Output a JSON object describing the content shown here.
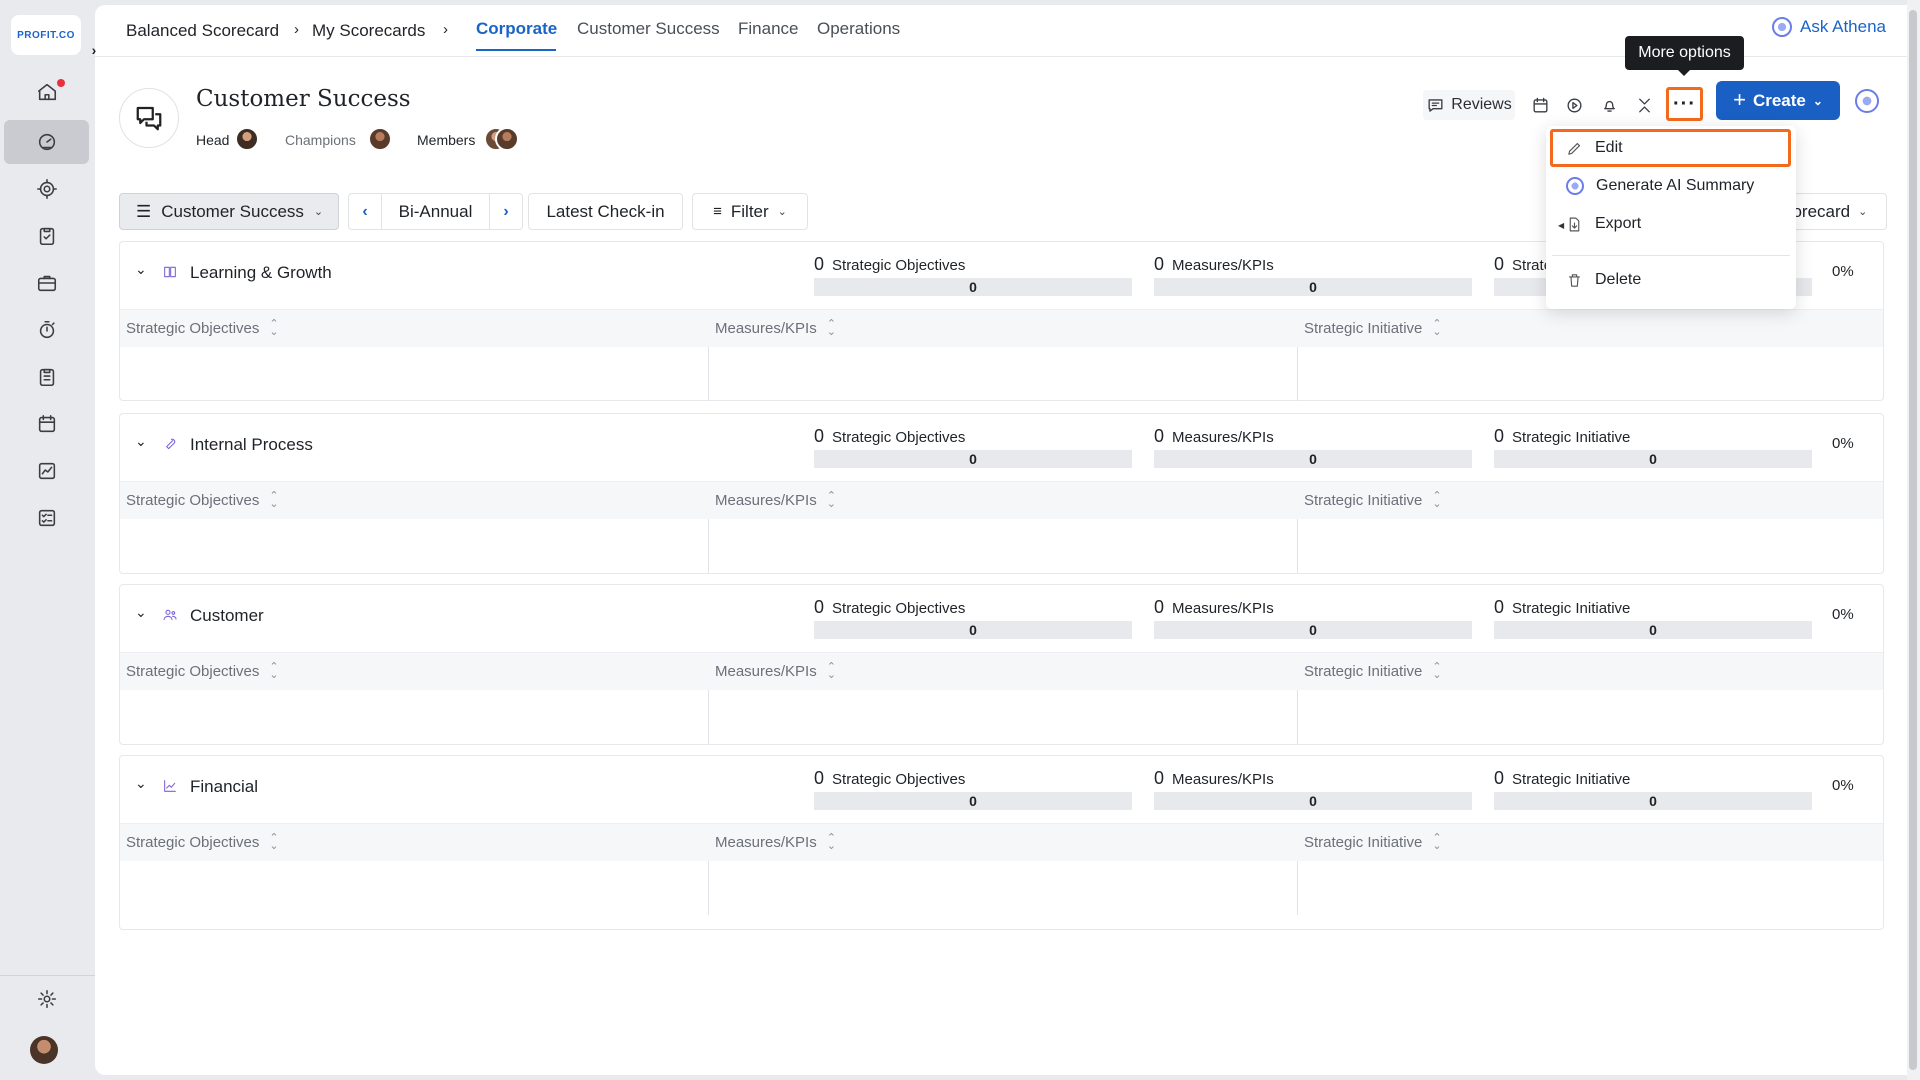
{
  "brand": {
    "logo_text": "PROFIT.CO"
  },
  "breadcrumb": {
    "root": "Balanced Scorecard",
    "parent": "My Scorecards"
  },
  "tabs": [
    {
      "label": "Corporate",
      "active": true
    },
    {
      "label": "Customer Success",
      "active": false
    },
    {
      "label": "Finance",
      "active": false
    },
    {
      "label": "Operations",
      "active": false
    }
  ],
  "ask_athena": "Ask Athena",
  "header": {
    "title": "Customer Success",
    "head_label": "Head",
    "champions_label": "Champions",
    "members_label": "Members",
    "reviews_label": "Reviews",
    "create_label": "Create",
    "tooltip": "More options"
  },
  "toolbar": {
    "group": "Customer Success",
    "period": "Bi-Annual",
    "checkin": "Latest Check-in",
    "filter": "Filter",
    "view": "Scorecard"
  },
  "menu": {
    "edit": "Edit",
    "ai_summary": "Generate AI Summary",
    "export": "Export",
    "delete": "Delete"
  },
  "columns": {
    "objectives": "Strategic Objectives",
    "measures": "Measures/KPIs",
    "initiative": "Strategic Initiative"
  },
  "perspectives": [
    {
      "name": "Learning & Growth",
      "objectives": 0,
      "measures": 0,
      "initiatives": 0,
      "objectives_bar": "0",
      "measures_bar": "0",
      "initiatives_bar": "0",
      "percent": "0%"
    },
    {
      "name": "Internal Process",
      "objectives": 0,
      "measures": 0,
      "initiatives": 0,
      "objectives_bar": "0",
      "measures_bar": "0",
      "initiatives_bar": "0",
      "percent": "0%"
    },
    {
      "name": "Customer",
      "objectives": 0,
      "measures": 0,
      "initiatives": 0,
      "objectives_bar": "0",
      "measures_bar": "0",
      "initiatives_bar": "0",
      "percent": "0%"
    },
    {
      "name": "Financial",
      "objectives": 0,
      "measures": 0,
      "initiatives": 0,
      "objectives_bar": "0",
      "measures_bar": "0",
      "initiatives_bar": "0",
      "percent": "0%"
    }
  ],
  "colors": {
    "accent": "#1a5fc4",
    "focus": "#f36a1d",
    "icon_purple": "#7d63d6"
  }
}
